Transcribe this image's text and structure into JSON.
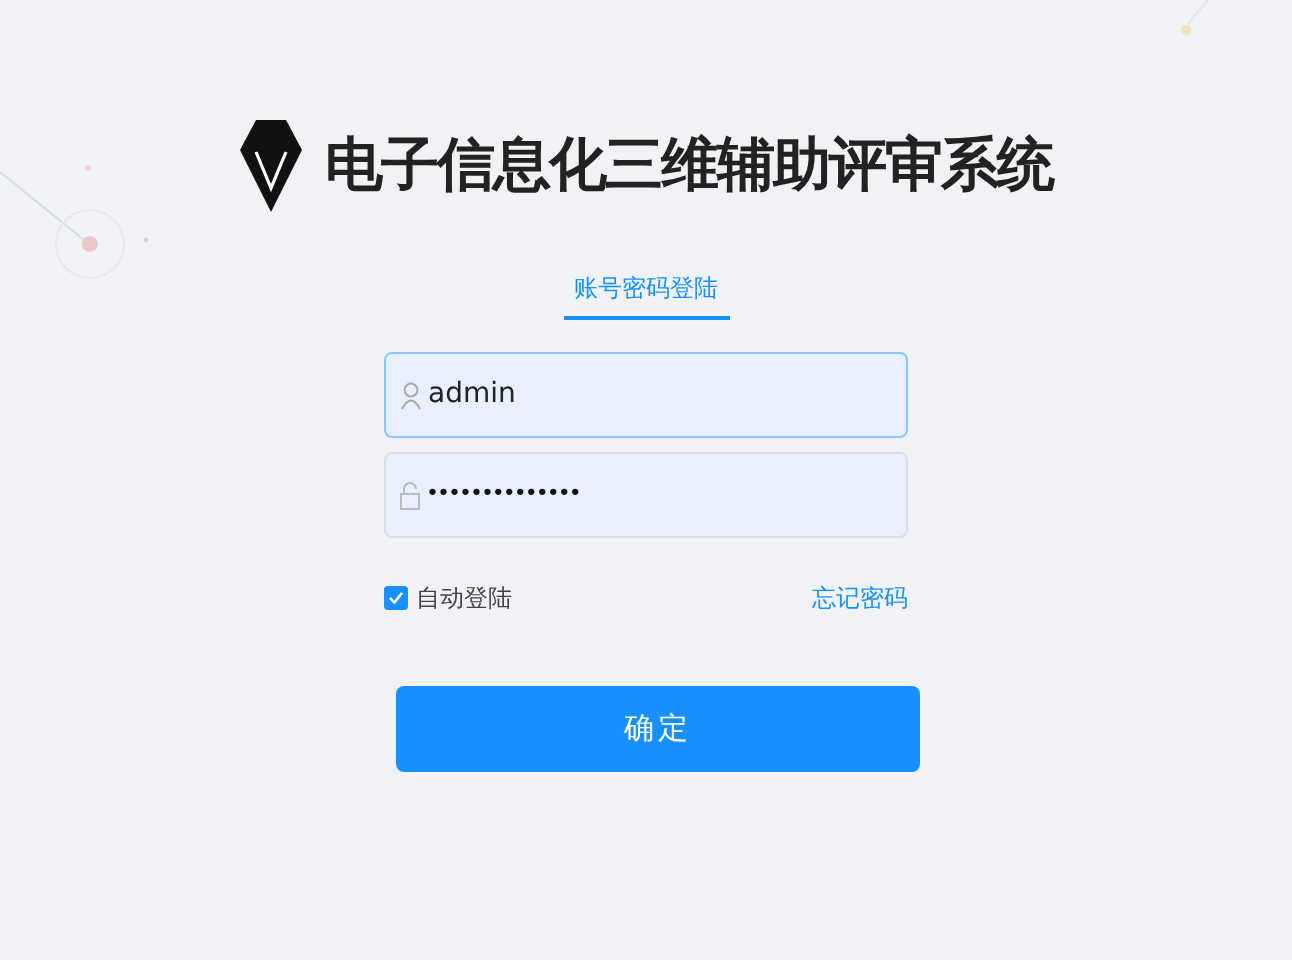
{
  "title": "电子信息化三维辅助评审系统",
  "tabs": [
    {
      "label": "账号密码登陆",
      "selected": true
    }
  ],
  "username": {
    "value": "admin"
  },
  "password": {
    "value": "••••••••••••••"
  },
  "auto_login": {
    "label": "自动登陆",
    "checked": true
  },
  "forgot_link": "忘记密码",
  "submit": "确定"
}
